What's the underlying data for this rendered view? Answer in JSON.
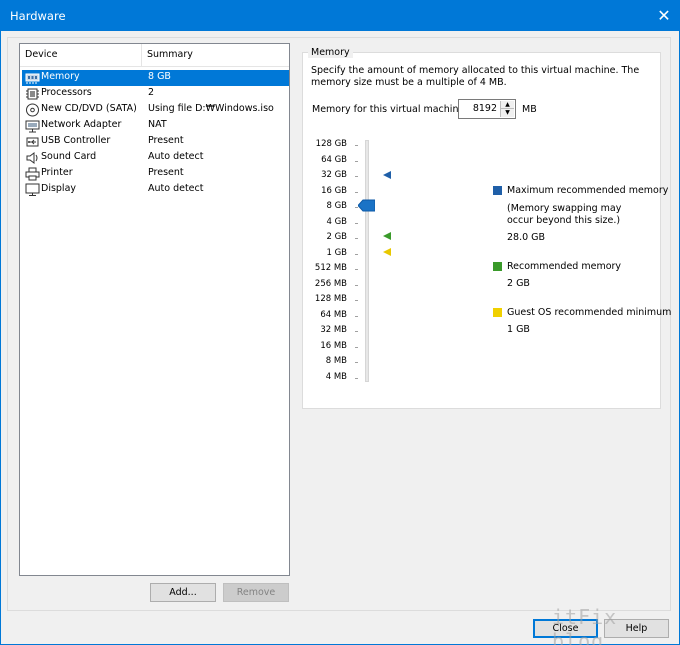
{
  "window": {
    "title": "Hardware",
    "close_glyph": "✕"
  },
  "device_list": {
    "col_device": "Device",
    "col_summary": "Summary",
    "rows": [
      {
        "name": "Memory",
        "summary": "8 GB",
        "icon": "memory-icon",
        "selected": true
      },
      {
        "name": "Processors",
        "summary": "2",
        "icon": "processor-icon"
      },
      {
        "name": "New CD/DVD (SATA)",
        "summary": "Using file D:₩Windows.iso",
        "icon": "cd-dvd-icon"
      },
      {
        "name": "Network Adapter",
        "summary": "NAT",
        "icon": "network-adapter-icon"
      },
      {
        "name": "USB Controller",
        "summary": "Present",
        "icon": "usb-icon"
      },
      {
        "name": "Sound Card",
        "summary": "Auto detect",
        "icon": "sound-card-icon"
      },
      {
        "name": "Printer",
        "summary": "Present",
        "icon": "printer-icon"
      },
      {
        "name": "Display",
        "summary": "Auto detect",
        "icon": "display-icon"
      }
    ]
  },
  "buttons": {
    "add": "Add...",
    "remove": "Remove",
    "close": "Close",
    "help": "Help"
  },
  "memory": {
    "group_title": "Memory",
    "description": "Specify the amount of memory allocated to this virtual machine. The memory size must be a multiple of 4 MB.",
    "field_label": "Memory for this virtual machine:",
    "value": "8192",
    "unit": "MB",
    "scale_labels": [
      "128 GB",
      "64 GB",
      "32 GB",
      "16 GB",
      "8 GB",
      "4 GB",
      "2 GB",
      "1 GB",
      "512 MB",
      "256 MB",
      "128 MB",
      "64 MB",
      "32 MB",
      "16 MB",
      "8 MB",
      "4 MB"
    ],
    "slider_value_label": "8 GB",
    "markers": {
      "max_recommended": "32 GB",
      "recommended": "2 GB",
      "guest_min": "1 GB"
    },
    "legend": {
      "max": {
        "title": "Maximum recommended memory",
        "note": "(Memory swapping may occur beyond this size.)",
        "value": "28.0 GB",
        "color": "#1f5fa8"
      },
      "recommended": {
        "title": "Recommended memory",
        "value": "2 GB",
        "color": "#3a9a2a"
      },
      "guest_min": {
        "title": "Guest OS recommended minimum",
        "value": "1 GB",
        "color": "#f0d000"
      }
    }
  },
  "watermark": "itFix blog",
  "colors": {
    "accent": "#0078d7",
    "selection": "#0078d7"
  }
}
